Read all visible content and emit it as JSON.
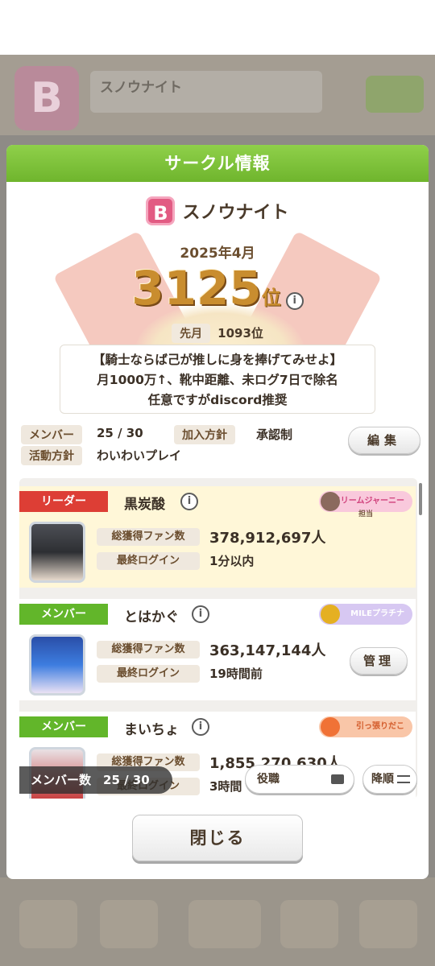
{
  "background": {
    "circle_name": "スノウナイト",
    "emblem_letter": "B"
  },
  "modal": {
    "title": "サークル情報",
    "emblem_letter": "B",
    "circle_name": "スノウナイト",
    "month": "2025年4月",
    "rank": "3125",
    "rank_unit": "位",
    "info_icon": "i",
    "last_month_label": "先月",
    "last_month_value": "1093位",
    "description": [
      "【騎士ならば己が推しに身を捧げてみせよ】",
      "月1000万↑、靴中距離、未ログ7日で除名",
      "任意ですがdiscord推奨"
    ],
    "meta": {
      "members_label": "メンバー",
      "members_value": "25 / 30",
      "join_label": "加入方針",
      "join_value": "承認制",
      "activity_label": "活動方針",
      "activity_value": "わいわいプレイ"
    },
    "edit_button": "編集",
    "members": [
      {
        "role": "リーダー",
        "name": "黒炭酸",
        "badge": "ドリームジャーニー",
        "badge_sub": "担当",
        "fans_label": "総獲得ファン数",
        "fans_value": "378,912,697人",
        "login_label": "最終ログイン",
        "login_value": "1分以内"
      },
      {
        "role": "メンバー",
        "name": "とはかぐ",
        "badge": "MILEプラチナ",
        "fans_label": "総獲得ファン数",
        "fans_value": "363,147,144人",
        "login_label": "最終ログイン",
        "login_value": "19時間前",
        "manage_button": "管理"
      },
      {
        "role": "メンバー",
        "name": "まいちょ",
        "badge": "引っ張りだこ",
        "fans_label": "総獲得ファン数",
        "fans_value": "1,855,270,630人",
        "login_label": "最終ログイン",
        "login_value": "3時間"
      }
    ],
    "footer": {
      "member_count": "メンバー数　25 / 30",
      "role_button": "役職",
      "sort_button": "降順"
    },
    "close_button": "閉じる"
  },
  "icons": [
    "info-icon",
    "emblem-icon",
    "role-filter-icon",
    "sort-icon"
  ]
}
